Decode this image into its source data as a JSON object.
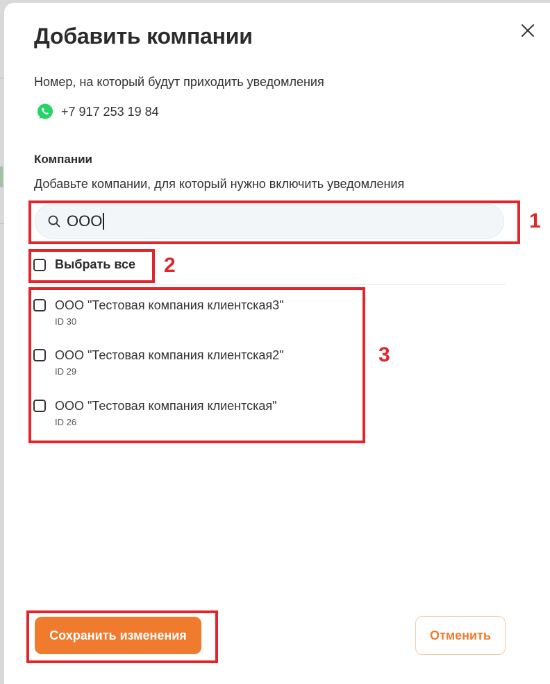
{
  "modal": {
    "title": "Добавить компании",
    "subtitle": "Номер, на который будут приходить уведомления",
    "phone": "+7 917 253 19 84",
    "phone_icon": "whatsapp-icon"
  },
  "companies_section": {
    "label": "Компании",
    "description": "Добавьте компании, для который нужно включить уведомления"
  },
  "search": {
    "value": "ООО",
    "icon": "search-icon"
  },
  "select_all": {
    "label": "Выбрать все",
    "checked": false
  },
  "companies": [
    {
      "name": "ООО \"Тестовая компания клиентская3\"",
      "id": "ID 30",
      "checked": false
    },
    {
      "name": "ООО \"Тестовая компания клиентская2\"",
      "id": "ID 29",
      "checked": false
    },
    {
      "name": "ООО \"Тестовая компания клиентская\"",
      "id": "ID 26",
      "checked": false
    }
  ],
  "annotations": [
    "1",
    "2",
    "3"
  ],
  "buttons": {
    "save": "Сохранить изменения",
    "cancel": "Отменить"
  },
  "colors": {
    "accent": "#f07a2e",
    "annotation": "#e0262b",
    "whatsapp": "#25d366"
  }
}
